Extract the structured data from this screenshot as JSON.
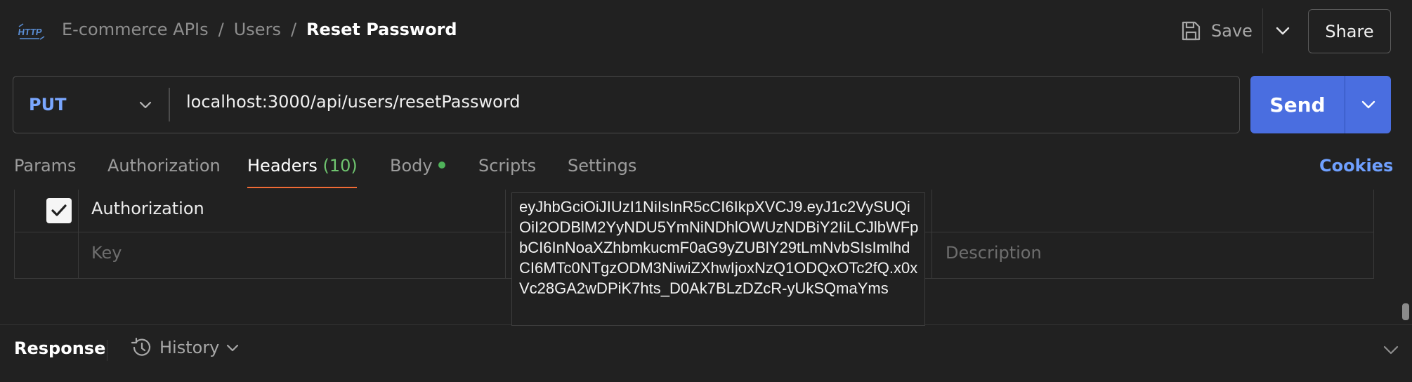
{
  "header": {
    "app_icon": "http-icon",
    "breadcrumb": [
      "E-commerce APIs",
      "Users",
      "Reset Password"
    ],
    "save_label": "Save",
    "share_label": "Share"
  },
  "request": {
    "method": "PUT",
    "url": "localhost:3000/api/users/resetPassword",
    "send_label": "Send"
  },
  "tabs": [
    {
      "label": "Params"
    },
    {
      "label": "Authorization"
    },
    {
      "label": "Headers",
      "count": "(10)"
    },
    {
      "label": "Body"
    },
    {
      "label": "Scripts"
    },
    {
      "label": "Settings"
    }
  ],
  "cookies_label": "Cookies",
  "headers_table": {
    "rows": [
      {
        "checked": true,
        "key": "Authorization",
        "value": "eyJhbGciOiJIUzI1NiIsInR5cCI6IkpXVCJ9.eyJ1c2VySUQiOiI2ODBlM2YyNDU5YmNiNDhlOWUzNDBiY2IiLCJlbWFpbCI6InNoaXZhbmkucmF0aG9yZUBlY29tLmNvbSIsImlhdCI6MTc0NTgzODM3NiwiZXhwIjoxNzQ1ODQxOTc2fQ.x0xVc28GA2wDPiK7hts_D0Ak7BLzDZcR-yUkSQmaYms"
      }
    ],
    "new_row": {
      "key_placeholder": "Key",
      "description_placeholder": "Description"
    }
  },
  "response": {
    "label": "Response",
    "history_label": "History"
  }
}
